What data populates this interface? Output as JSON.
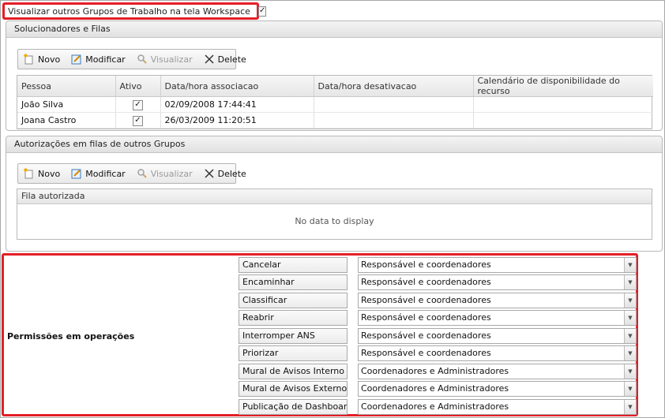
{
  "top_option": {
    "label": "Visualizar outros Grupos de Trabalho na tela Workspace",
    "checked": true,
    "check_glyph": "✓"
  },
  "panel1": {
    "title": "Solucionadores e Filas",
    "toolbar": {
      "new_label": "Novo",
      "edit_label": "Modificar",
      "view_label": "Visualizar",
      "delete_label": "Delete"
    },
    "columns": [
      "Pessoa",
      "Ativo",
      "Data/hora associacao",
      "Data/hora desativacao",
      "Calendário de disponibilidade do recurso"
    ],
    "rows": [
      {
        "pessoa": "João Silva",
        "ativo": "✓",
        "assoc": "02/09/2008 17:44:41",
        "desat": "",
        "cal": ""
      },
      {
        "pessoa": "Joana Castro",
        "ativo": "✓",
        "assoc": "26/03/2009 11:20:51",
        "desat": "",
        "cal": ""
      }
    ]
  },
  "panel2": {
    "title": "Autorizações em filas de outros Grupos",
    "toolbar": {
      "new_label": "Novo",
      "edit_label": "Modificar",
      "view_label": "Visualizar",
      "delete_label": "Delete"
    },
    "columns": [
      "Fila autorizada"
    ],
    "empty_text": "No data to display"
  },
  "permissions": {
    "title": "Permissões em operações",
    "rows": [
      {
        "operation": "Cancelar",
        "value": "Responsável e coordenadores"
      },
      {
        "operation": "Encaminhar",
        "value": "Responsável e coordenadores"
      },
      {
        "operation": "Classificar",
        "value": "Responsável e coordenadores"
      },
      {
        "operation": "Reabrir",
        "value": "Responsável e coordenadores"
      },
      {
        "operation": "Interromper ANS",
        "value": "Responsável e coordenadores"
      },
      {
        "operation": "Priorizar",
        "value": "Responsável e coordenadores"
      },
      {
        "operation": "Mural de Avisos Interno",
        "value": "Coordenadores e Administradores"
      },
      {
        "operation": "Mural de Avisos Externo",
        "value": "Coordenadores e Administradores"
      },
      {
        "operation": "Publicação de Dashboard",
        "value": "Coordenadores e Administradores"
      }
    ]
  },
  "icons": {
    "new": "new-document-icon",
    "edit": "edit-pencil-icon",
    "view": "magnifier-icon",
    "delete": "delete-x-icon",
    "dropdown": "chevron-down-icon"
  },
  "colors": {
    "highlight": "#e41e26",
    "border": "#b8b8b8",
    "header_bg": "#e6e6e6"
  }
}
